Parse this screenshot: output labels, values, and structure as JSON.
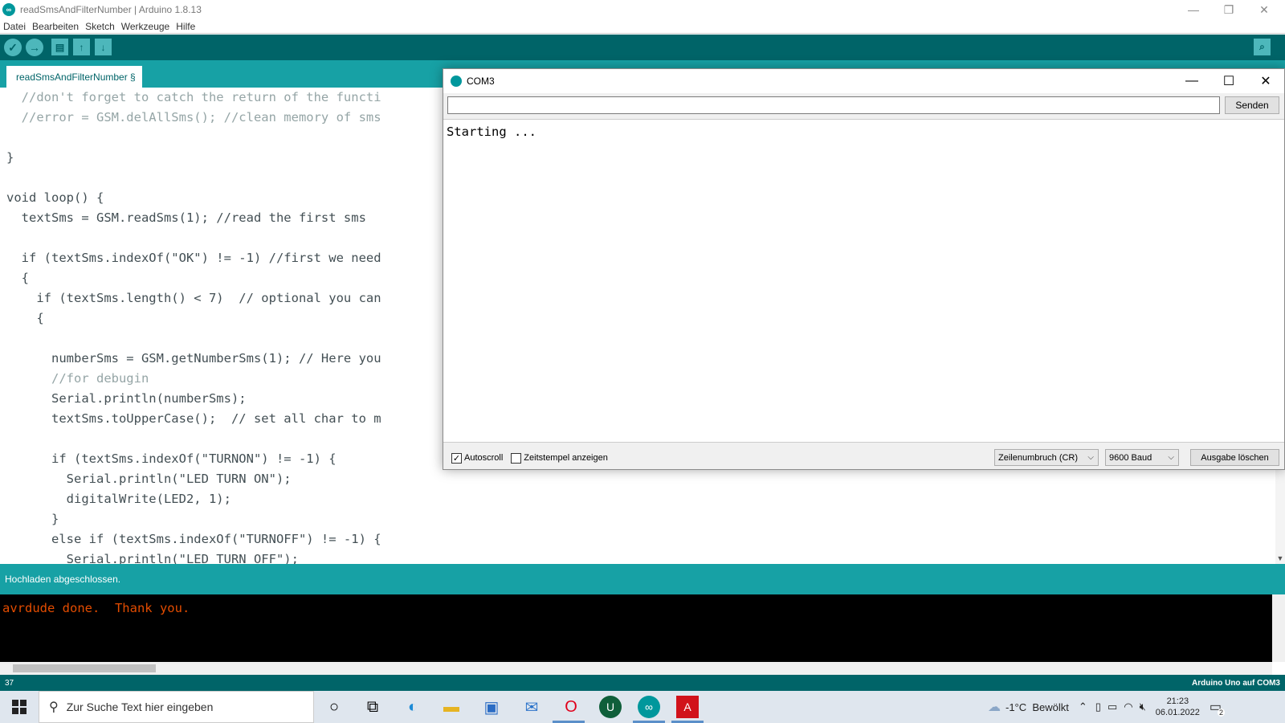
{
  "window": {
    "title": "readSmsAndFilterNumber | Arduino 1.8.13",
    "min": "—",
    "restore": "❐",
    "close": "✕"
  },
  "menu": [
    "Datei",
    "Bearbeiten",
    "Sketch",
    "Werkzeuge",
    "Hilfe"
  ],
  "toolbar": {
    "verify_icon": "✓",
    "upload_icon": "→",
    "new_icon": "▤",
    "open_icon": "↑",
    "save_icon": "↓",
    "serial_monitor_icon": "⌕"
  },
  "tab": {
    "label": "readSmsAndFilterNumber §"
  },
  "code_lines": [
    "  //don't forget to catch the return of the functi",
    "  //error = GSM.delAllSms(); //clean memory of sms",
    "",
    "}",
    "",
    "void loop() {",
    "  textSms = GSM.readSms(1); //read the first sms",
    "",
    "  if (textSms.indexOf(\"OK\") != -1) //first we need",
    "  {",
    "    if (textSms.length() < 7)  // optional you can",
    "    {",
    "",
    "      numberSms = GSM.getNumberSms(1); // Here you",
    "      //for debugin",
    "      Serial.println(numberSms);",
    "      textSms.toUpperCase();  // set all char to m",
    "",
    "      if (textSms.indexOf(\"TURNON\") != -1) {",
    "        Serial.println(\"LED TURN ON\");",
    "        digitalWrite(LED2, 1);",
    "      }",
    "      else if (textSms.indexOf(\"TURNOFF\") != -1) {",
    "        Serial.println(\"LED TURN OFF\");"
  ],
  "status": {
    "message": "Hochladen abgeschlossen."
  },
  "console": {
    "text": "avrdude done.  Thank you."
  },
  "bottombar": {
    "line": "37",
    "board": "Arduino Uno auf COM3"
  },
  "serial_monitor": {
    "title": "COM3",
    "input_value": "",
    "send_label": "Senden",
    "output": "Starting ...",
    "autoscroll_label": "Autoscroll",
    "autoscroll_checked": true,
    "timestamp_label": "Zeitstempel anzeigen",
    "timestamp_checked": false,
    "line_ending": "Zeilenumbruch (CR)",
    "baud": "9600 Baud",
    "clear_label": "Ausgabe löschen"
  },
  "taskbar": {
    "search_placeholder": "Zur Suche Text hier eingeben",
    "weather": "-1°C  Bewölkt",
    "time": "21:23",
    "date": "06.01.2022",
    "notification_count": "2",
    "icons": [
      "cortana-icon",
      "task-view-icon",
      "edge-icon",
      "file-explorer-icon",
      "store-icon",
      "mail-icon",
      "opera-icon",
      "upwork-icon",
      "arduino-icon",
      "acrobat-icon"
    ]
  },
  "colors": {
    "arduino_dark": "#006468",
    "arduino_teal": "#17a1a5",
    "console_text": "#e34c00"
  }
}
